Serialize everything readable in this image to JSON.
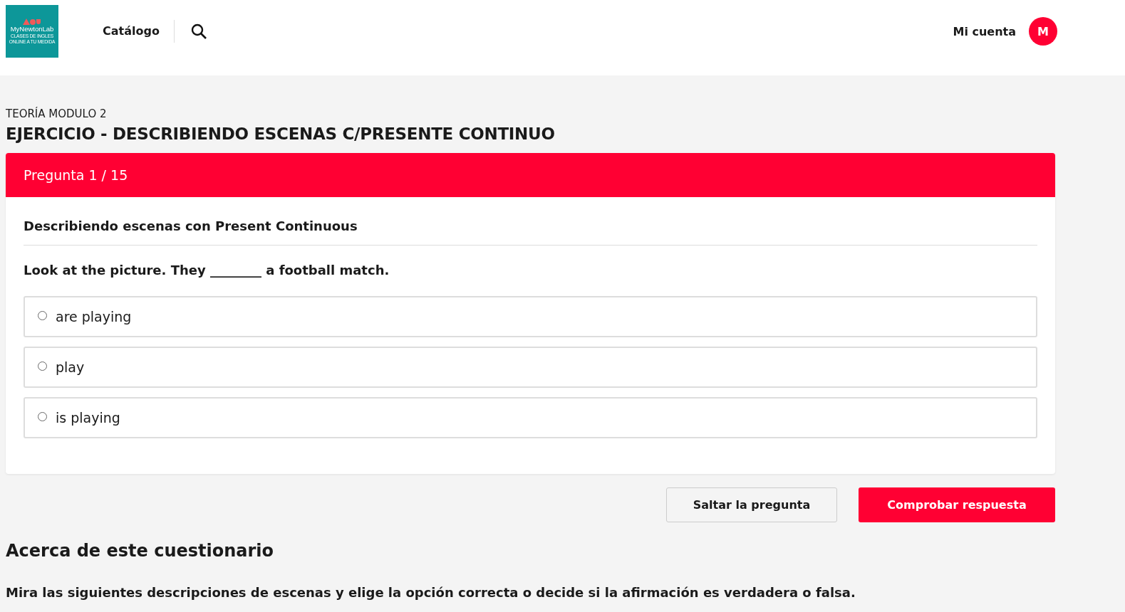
{
  "header": {
    "logo": {
      "name": "MyNewtonLab",
      "tagline_1": "CLASES DE INGLES",
      "tagline_2": "ONLINE A TU MEDIDA"
    },
    "nav": "Catálogo",
    "account": "Mi cuenta",
    "avatar": "M"
  },
  "breadcrumb": "TEORÍA MODULO 2",
  "title": "EJERCICIO - DESCRIBIENDO ESCENAS C/PRESENTE CONTINUO",
  "question": {
    "counter": "Pregunta 1 / 15",
    "heading": "Describiendo escenas con Present Continuous",
    "prompt": "Look at the picture. They ________ a football match.",
    "options": [
      {
        "label": "are playing",
        "selected": false
      },
      {
        "label": "play",
        "selected": false
      },
      {
        "label": "is playing",
        "selected": false
      }
    ]
  },
  "buttons": {
    "skip": "Saltar la pregunta",
    "check": "Comprobar respuesta"
  },
  "about": {
    "title": "Acerca de este cuestionario",
    "text": "Mira las siguientes descripciones de escenas y elige la opción correcta o decide si la afirmación es verdadera o falsa."
  }
}
